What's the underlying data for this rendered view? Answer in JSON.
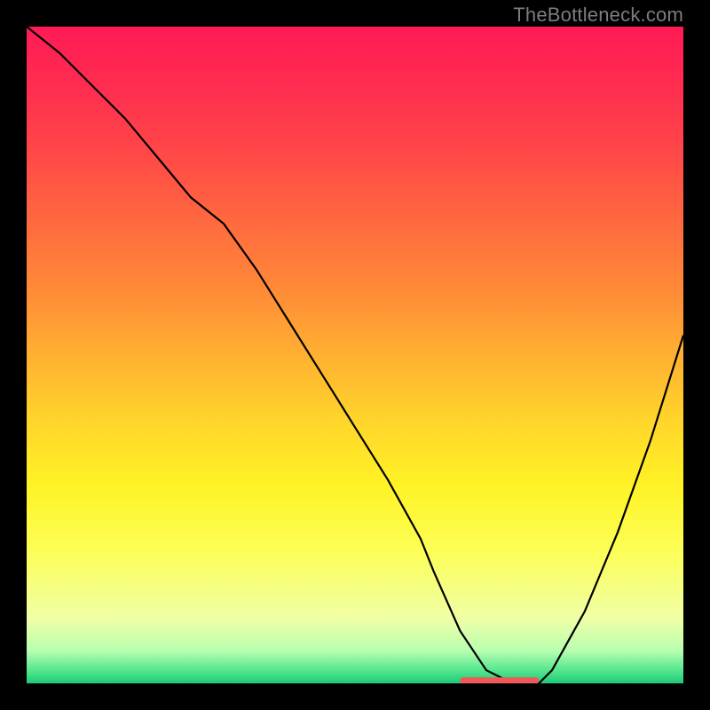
{
  "watermark": "TheBottleneck.com",
  "chart_data": {
    "type": "line",
    "title": "",
    "xlabel": "",
    "ylabel": "",
    "xlim": [
      0,
      100
    ],
    "ylim": [
      0,
      100
    ],
    "gradient_stops": [
      {
        "offset": 0,
        "color": "#ff1a56"
      },
      {
        "offset": 10,
        "color": "#ff2f4f"
      },
      {
        "offset": 20,
        "color": "#ff4a47"
      },
      {
        "offset": 30,
        "color": "#ff6a3f"
      },
      {
        "offset": 40,
        "color": "#ff8a37"
      },
      {
        "offset": 50,
        "color": "#ffb031"
      },
      {
        "offset": 60,
        "color": "#ffd52b"
      },
      {
        "offset": 70,
        "color": "#fff326"
      },
      {
        "offset": 80,
        "color": "#fcff58"
      },
      {
        "offset": 90,
        "color": "#f0ffa5"
      },
      {
        "offset": 95,
        "color": "#b9ffb0"
      },
      {
        "offset": 98,
        "color": "#55e68e"
      },
      {
        "offset": 100,
        "color": "#1fc97a"
      }
    ],
    "series": [
      {
        "name": "bottleneck-curve",
        "x": [
          0,
          5,
          10,
          15,
          20,
          25,
          30,
          35,
          40,
          45,
          50,
          55,
          60,
          62,
          66,
          70,
          74,
          78,
          80,
          85,
          90,
          95,
          100
        ],
        "y": [
          100,
          96,
          91,
          86,
          80,
          74,
          70,
          63,
          55,
          47,
          39,
          31,
          22,
          17,
          8,
          2,
          0,
          0,
          2,
          11,
          23,
          37,
          53
        ]
      }
    ],
    "highlight_segment": {
      "x_start": 66,
      "x_end": 78,
      "y": 0.5,
      "color": "#ef5a58"
    }
  }
}
